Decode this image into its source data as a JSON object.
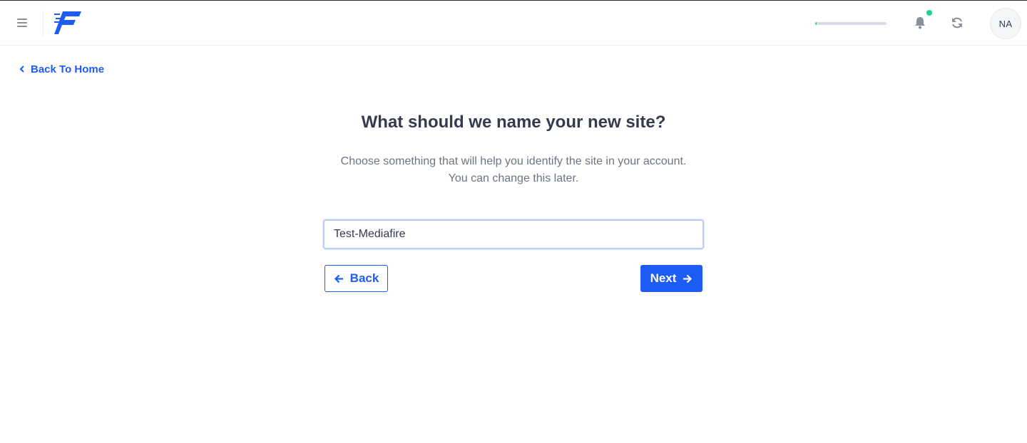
{
  "header": {
    "menu_icon": "hamburger-menu-icon",
    "logo_icon": "brand-logo-icon",
    "progress_fraction": 0.02,
    "notifications_icon": "bell-icon",
    "has_new_notifications": true,
    "refresh_icon": "refresh-icon",
    "avatar_initials": "NA"
  },
  "nav": {
    "back_home_label": "Back To Home"
  },
  "main": {
    "title": "What should we name your new site?",
    "subtitle_line1": "Choose something that will help you identify the site in your account.",
    "subtitle_line2": "You can change this later.",
    "site_name_value": "Test-Mediafire",
    "back_label": "Back",
    "next_label": "Next"
  },
  "colors": {
    "accent": "#1d5cf5",
    "status_green": "#1cd290",
    "heading": "#363a4e",
    "muted": "#6e7385"
  }
}
